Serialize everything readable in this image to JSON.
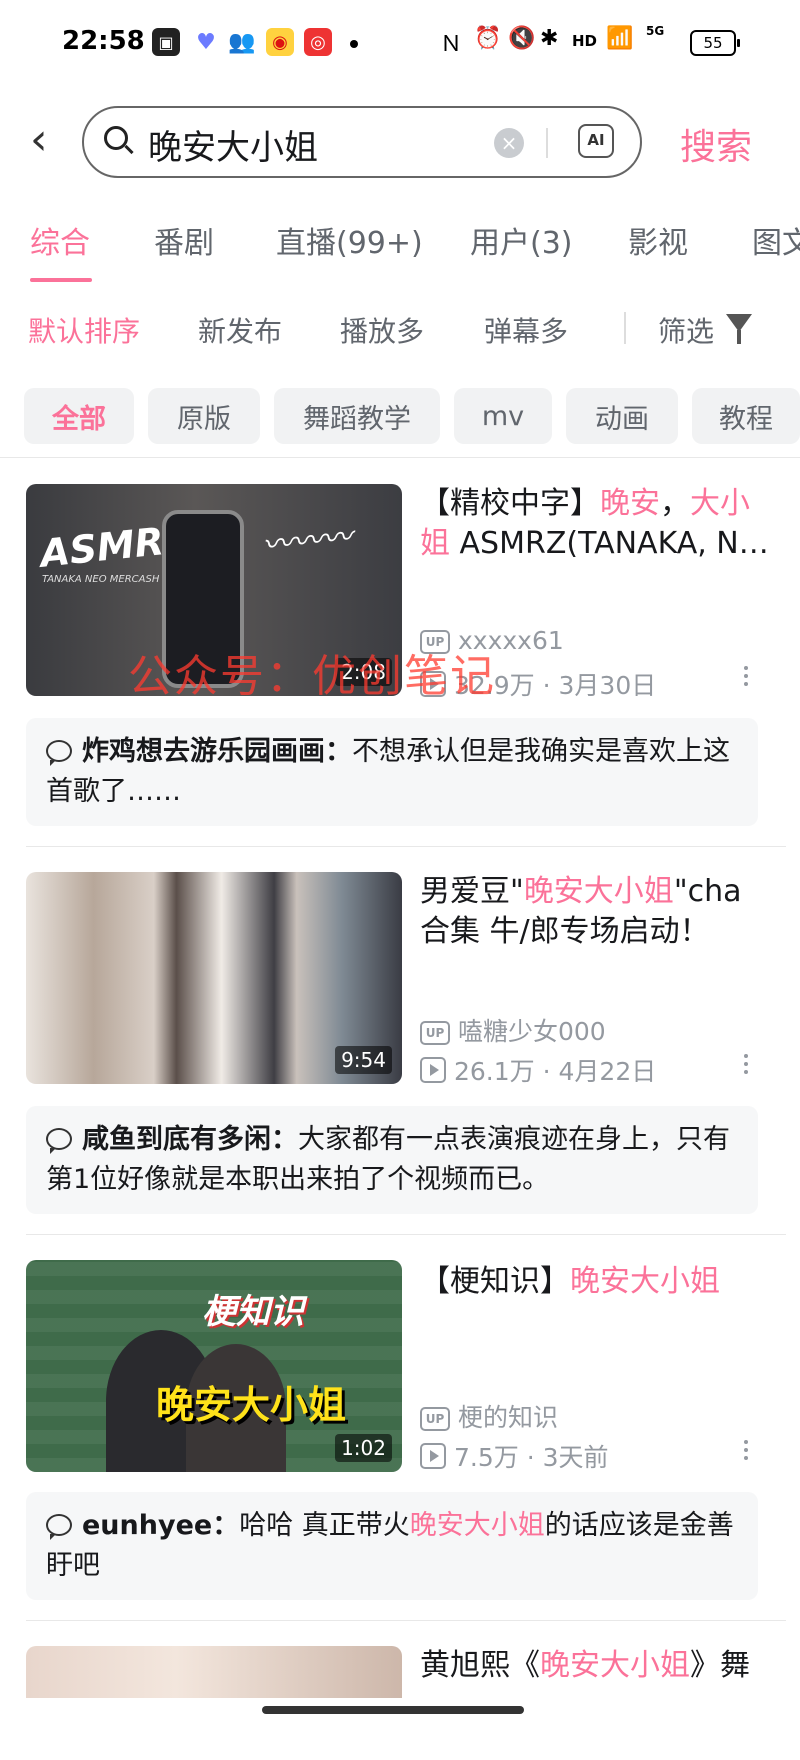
{
  "status_bar": {
    "time": "22:58",
    "network": "HD",
    "signal": "5G",
    "battery": "55"
  },
  "search": {
    "query": "晚安大小姐",
    "ai_label": "AI",
    "button_label": "搜索"
  },
  "tabs": [
    "综合",
    "番剧",
    "直播(99+)",
    "用户(3)",
    "影视",
    "图文"
  ],
  "sort_options": [
    "默认排序",
    "新发布",
    "播放多",
    "弹幕多"
  ],
  "filter_label": "筛选",
  "chips": [
    "全部",
    "原版",
    "舞蹈教学",
    "mv",
    "动画",
    "教程"
  ],
  "watermark": "公众号：优创笔记",
  "videos": [
    {
      "title_pre": "【精校中字】",
      "title_hl1": "晚安",
      "title_mid": "，",
      "title_hl2": "大小姐",
      "title_post": " ASMRZ(TANAKA, N…",
      "thumb_text_left": "ASMRZ",
      "thumb_text_sub": "TANAKA NEO MERCASH",
      "duration": "2:08",
      "uploader": "xxxxx61",
      "views": "32.9万",
      "date": "3月30日",
      "comment_user": "炸鸡想去游乐园画画",
      "comment_text": "不想承认但是我确实是喜欢上这首歌了……"
    },
    {
      "title_pre": "男爱豆\"",
      "title_hl1": "晚安大小姐",
      "title_post": "\"cha合集 牛/郎专场启动！",
      "duration": "9:54",
      "uploader": "嗑糖少女000",
      "views": "26.1万",
      "date": "4月22日",
      "comment_user": "咸鱼到底有多闲",
      "comment_text": "大家都有一点表演痕迹在身上，只有第1位好像就是本职出来拍了个视频而已。"
    },
    {
      "title_pre": "【梗知识】",
      "title_hl1": "晚安大小姐",
      "thumb_text_top": "梗知识",
      "thumb_text_main": "晚安大小姐",
      "duration": "1:02",
      "uploader": "梗的知识",
      "views": "7.5万",
      "date": "3天前",
      "comment_user": "eunhyee",
      "comment_pre": "哈哈 真正带火",
      "comment_hl": "晚安大小姐",
      "comment_post": "的话应该是金善盱吧"
    },
    {
      "title_pre": "黄旭熙《",
      "title_hl1": "晚安大小姐",
      "title_post": "》舞"
    }
  ],
  "colors": {
    "accent": "#fb7299",
    "text": "#18191c",
    "muted": "#9499a0"
  }
}
